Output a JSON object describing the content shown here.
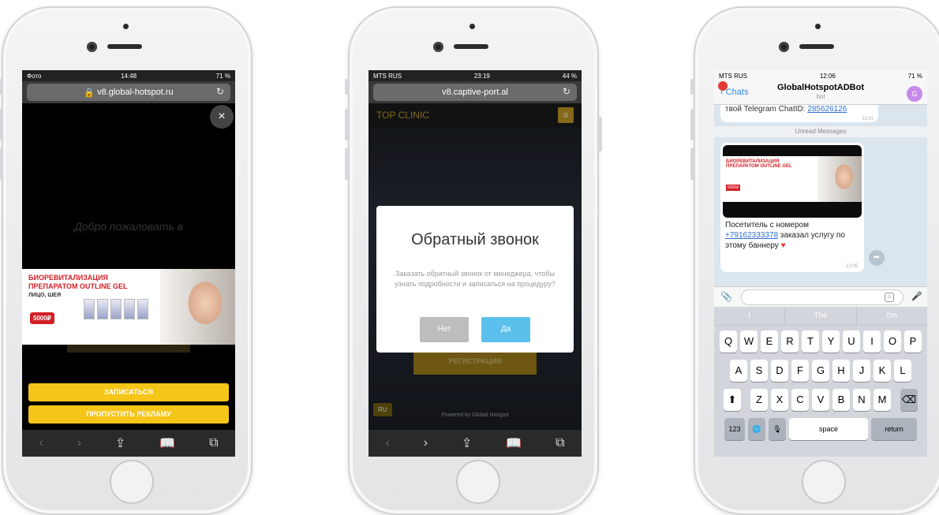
{
  "phone1": {
    "status": {
      "carrier": "Фото",
      "time": "14:48",
      "battery": "71 %"
    },
    "url": "v8.global-hotspot.ru",
    "close_label": "×",
    "welcome_text": "Добро пожаловать в",
    "banner": {
      "title": "БИОРЕВИТАЛИЗАЦИЯ ПРЕПАРАТОМ OUTLINE GEL",
      "subtitle": "ЛИЦО, ШЕЯ",
      "price": "5000₽"
    },
    "buttons": {
      "signup": "ЗАПИСАТЬСЯ",
      "skip": "ПРОПУСТИТЬ РЕКЛАМУ"
    }
  },
  "phone2": {
    "status": {
      "carrier": "MTS RUS",
      "time": "23:19",
      "battery": "44 %"
    },
    "url": "v8.captive-port.al",
    "brand": "TOP CLINIC",
    "menu_icon": "≡",
    "register_label": "РЕГИСТРАЦИЯ",
    "lang": "RU",
    "powered": "Powered by Global Hotspot",
    "modal": {
      "title": "Обратный звонок",
      "body": "Заказать обратный звонок от менеджера, чтобы узнать подробности и записаться на процедуру?",
      "no": "Нет",
      "yes": "Да"
    }
  },
  "phone3": {
    "status": {
      "carrier": "MTS RUS",
      "time": "12:06",
      "battery": "71 %"
    },
    "back_label": "Chats",
    "bot_name": "GlobalHotspotADBot",
    "bot_sub": "bot",
    "avatar_letter": "G",
    "prev_message": {
      "text": "твой Telegram ChatID:",
      "id": "285626126",
      "time": "11:01"
    },
    "unread": "Unread Messages",
    "message": {
      "line1": "Посетитель с номером",
      "phone": "+79162333378",
      "line2": " заказал услугу по этому баннеру",
      "time": "12:05"
    },
    "suggestions": [
      "I",
      "The",
      "I'm"
    ],
    "keys_row1": [
      "Q",
      "W",
      "E",
      "R",
      "T",
      "Y",
      "U",
      "I",
      "O",
      "P"
    ],
    "keys_row2": [
      "A",
      "S",
      "D",
      "F",
      "G",
      "H",
      "J",
      "K",
      "L"
    ],
    "keys_row3": [
      "Z",
      "X",
      "C",
      "V",
      "B",
      "N",
      "M"
    ],
    "shift": "⬆",
    "backspace": "⌫",
    "num_key": "123",
    "globe": "🌐",
    "mic": "🎙",
    "space": "space",
    "return": "return"
  },
  "colors": {
    "yellow": "#f5c518",
    "gold": "#c9a227",
    "tg_blue": "#2d8bea",
    "modal_yes": "#5bc0eb",
    "modal_no": "#bdbdbd"
  }
}
